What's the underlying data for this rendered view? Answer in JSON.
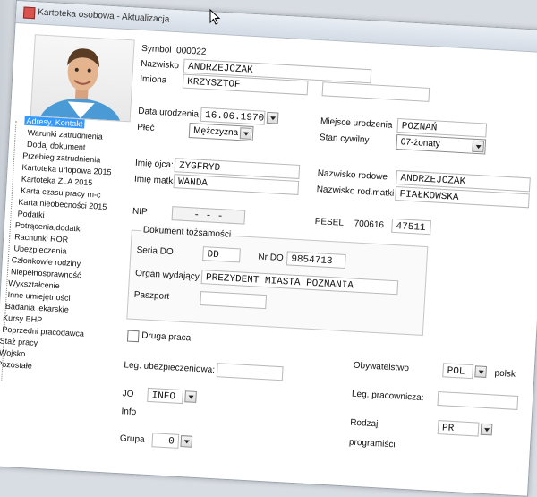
{
  "window": {
    "title": "Kartoteka osobowa - Aktualizacja"
  },
  "tree": [
    {
      "label": "Adresy, Kontakt"
    },
    {
      "label": "Warunki zatrudnienia"
    },
    {
      "label": "Dodaj dokument"
    },
    {
      "label": "Przebieg zatrudnienia"
    },
    {
      "label": "Kartoteka urlopowa 2015"
    },
    {
      "label": "Kartoteka ZLA 2015"
    },
    {
      "label": "Karta czasu pracy m-c"
    },
    {
      "label": "Karta nieobecności 2015"
    },
    {
      "label": "Podatki"
    },
    {
      "label": "Potrącenia,dodatki"
    },
    {
      "label": "Rachunki ROR"
    },
    {
      "label": "Ubezpieczenia"
    },
    {
      "label": "Członkowie rodziny"
    },
    {
      "label": "Niepełnosprawność"
    },
    {
      "label": "Wykształcenie"
    },
    {
      "label": "Inne umiejętności"
    },
    {
      "label": "Badania lekarskie"
    },
    {
      "label": "Kursy BHP"
    },
    {
      "label": "Poprzedni pracodawca"
    },
    {
      "label": "Staż pracy"
    },
    {
      "label": "Wojsko"
    },
    {
      "label": "Pozostałe"
    }
  ],
  "form": {
    "symbol_label": "Symbol",
    "symbol_value": "000022",
    "nazwisko_label": "Nazwisko",
    "nazwisko_value": "ANDRZEJCZAK",
    "imiona_label": "Imiona",
    "imiona_value": "KRZYSZTOF",
    "data_ur_label": "Data urodzenia",
    "data_ur_value": "16.06.1970",
    "plec_label": "Płeć",
    "plec_value": "Mężczyzna",
    "miejsce_label": "Miejsce urodzenia",
    "miejsce_value": "POZNAŃ",
    "stan_label": "Stan cywilny",
    "stan_value": "07-żonaty",
    "imie_ojca_label": "Imię ojca:",
    "imie_ojca_value": "ZYGFRYD",
    "imie_matki_label": "Imię matki",
    "imie_matki_value": "WANDA",
    "nazw_rod_label": "Nazwisko rodowe",
    "nazw_rod_value": "ANDRZEJCZAK",
    "nazw_rod_matki_label": "Nazwisko rod.matki",
    "nazw_rod_matki_value": "FIAŁKOWSKA",
    "nip_label": "NIP",
    "nip_value": "-   -   -",
    "pesel_label": "PESEL",
    "pesel_prefix": "700616",
    "pesel_value": "47511"
  },
  "doc": {
    "title": "Dokument tożsamości",
    "seria_label": "Seria DO",
    "seria_value": "DD",
    "nr_label": "Nr DO",
    "nr_value": "9854713",
    "organ_label": "Organ wydający",
    "organ_value": "PREZYDENT MIASTA POZNANIA",
    "paszport_label": "Paszport"
  },
  "bottom": {
    "druga_praca_label": "Druga praca",
    "leg_ubezp_label": "Leg. ubezpieczeniowa:",
    "jo_label": "JO",
    "jo_value": "INFO",
    "info_label": "Info",
    "grupa_label": "Grupa",
    "grupa_value": "0",
    "obyw_label": "Obywatelstwo",
    "obyw_value": "POL",
    "obyw_suffix": "polsk",
    "leg_prac_label": "Leg. pracownicza:",
    "rodzaj_label": "Rodzaj",
    "rodzaj_value": "PR",
    "programisci_label": "programiści"
  }
}
